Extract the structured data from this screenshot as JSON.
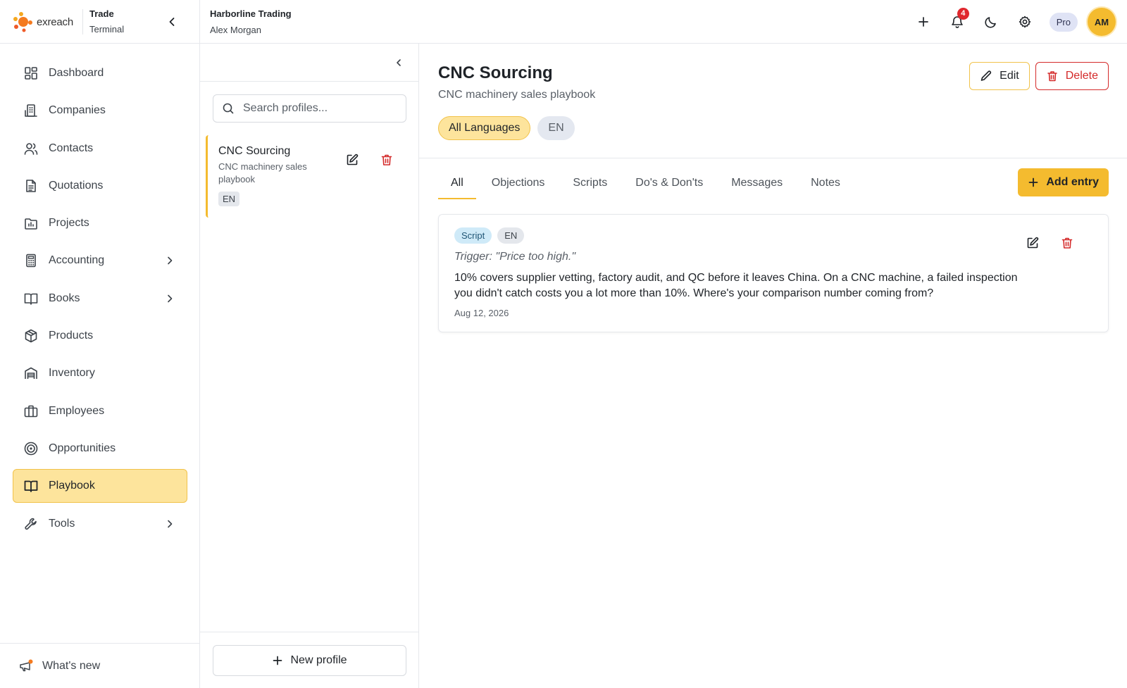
{
  "brand": {
    "logo_text": "exreach",
    "name": "Trade",
    "subtitle": "Terminal"
  },
  "org": {
    "name": "Harborline Trading",
    "user": "Alex Morgan"
  },
  "topbar": {
    "notification_count": "4",
    "plan": "Pro",
    "avatar_initials": "AM"
  },
  "sidebar": {
    "items": [
      {
        "label": "Dashboard",
        "icon": "dashboard-icon"
      },
      {
        "label": "Companies",
        "icon": "building-icon"
      },
      {
        "label": "Contacts",
        "icon": "users-icon"
      },
      {
        "label": "Quotations",
        "icon": "document-icon"
      },
      {
        "label": "Projects",
        "icon": "folder-chart-icon"
      },
      {
        "label": "Accounting",
        "icon": "calculator-icon",
        "has_submenu": true
      },
      {
        "label": "Books",
        "icon": "book-open-icon",
        "has_submenu": true
      },
      {
        "label": "Products",
        "icon": "package-icon"
      },
      {
        "label": "Inventory",
        "icon": "warehouse-icon"
      },
      {
        "label": "Employees",
        "icon": "briefcase-icon"
      },
      {
        "label": "Opportunities",
        "icon": "target-icon"
      },
      {
        "label": "Playbook",
        "icon": "book-open-icon",
        "active": true
      },
      {
        "label": "Tools",
        "icon": "wrench-icon",
        "has_submenu": true
      }
    ],
    "whats_new": "What's new"
  },
  "profiles": {
    "search_placeholder": "Search profiles...",
    "items": [
      {
        "title": "CNC Sourcing",
        "description": "CNC machinery sales playbook",
        "language": "EN"
      }
    ],
    "new_profile_label": "New profile"
  },
  "main": {
    "title": "CNC Sourcing",
    "subtitle": "CNC machinery sales playbook",
    "language_filters": [
      "All Languages",
      "EN"
    ],
    "edit_label": "Edit",
    "delete_label": "Delete",
    "tabs": [
      "All",
      "Objections",
      "Scripts",
      "Do's & Don'ts",
      "Messages",
      "Notes"
    ],
    "active_tab": "All",
    "add_entry_label": "Add entry",
    "entries": [
      {
        "type": "Script",
        "language": "EN",
        "trigger": "Trigger: \"Price too high.\"",
        "body": "10% covers supplier vetting, factory audit, and QC before it leaves China. On a CNC machine, a failed inspection you didn't catch costs you a lot more than 10%. Where's your comparison number coming from?",
        "date": "Aug 12, 2026"
      }
    ]
  },
  "colors": {
    "accent": "#f4bb2f",
    "accent_soft": "#fde49c",
    "danger": "#d42a2a",
    "badge": "#e0282e"
  }
}
